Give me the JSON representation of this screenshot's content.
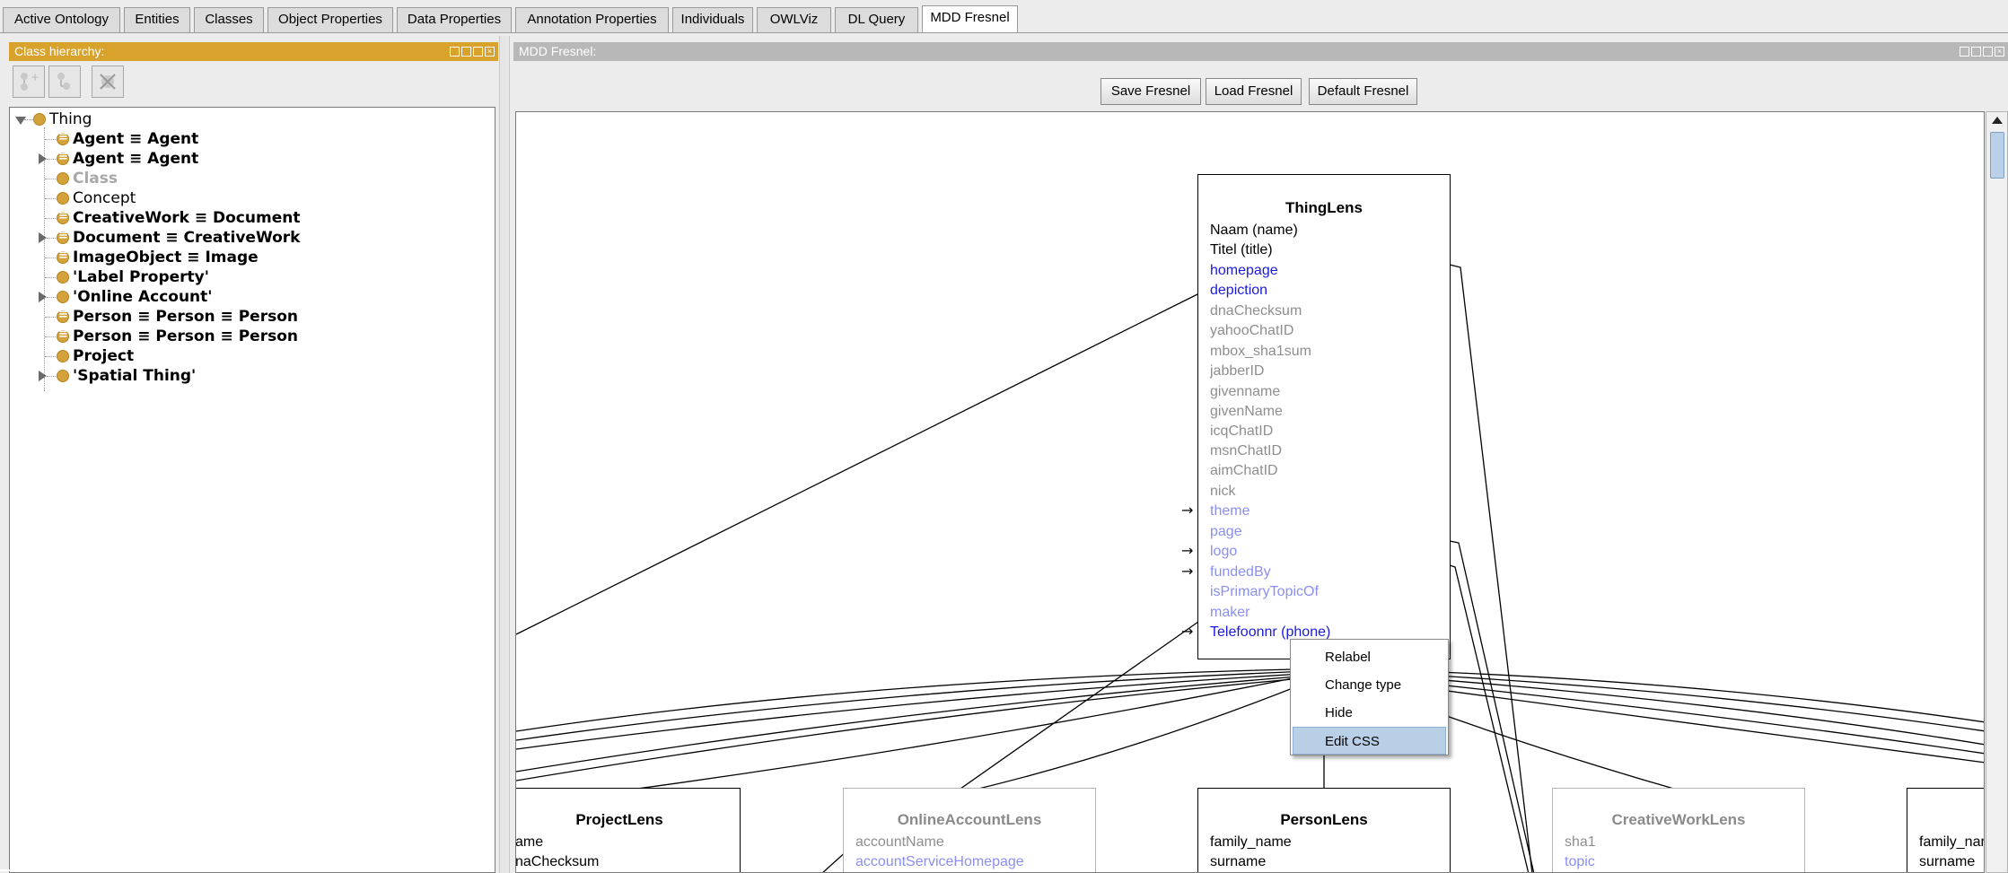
{
  "tabs": [
    {
      "label": "Active Ontology",
      "active": false
    },
    {
      "label": "Entities",
      "active": false
    },
    {
      "label": "Classes",
      "active": false
    },
    {
      "label": "Object Properties",
      "active": false
    },
    {
      "label": "Data Properties",
      "active": false
    },
    {
      "label": "Annotation Properties",
      "active": false
    },
    {
      "label": "Individuals",
      "active": false
    },
    {
      "label": "OWLViz",
      "active": false
    },
    {
      "label": "DL Query",
      "active": false
    },
    {
      "label": "MDD Fresnel",
      "active": true
    }
  ],
  "class_hierarchy": {
    "title": "Class hierarchy:",
    "toolbar_icons": [
      "add-subclass-icon",
      "add-sibling-class-icon",
      "delete-class-icon"
    ],
    "items": [
      {
        "label": "Thing",
        "style": "normal",
        "icon": "class-icon"
      },
      {
        "label": "Agent ≡ Agent",
        "style": "bold",
        "icon": "equivalent-class-icon"
      },
      {
        "label": "Agent ≡ Agent",
        "style": "bold",
        "icon": "equivalent-class-icon"
      },
      {
        "label": "Class",
        "style": "grey",
        "icon": "class-icon"
      },
      {
        "label": "Concept",
        "style": "normal",
        "icon": "class-icon"
      },
      {
        "label": "CreativeWork ≡ Document",
        "style": "bold",
        "icon": "equivalent-class-icon"
      },
      {
        "label": "Document ≡ CreativeWork",
        "style": "bold",
        "icon": "equivalent-class-icon"
      },
      {
        "label": "ImageObject ≡ Image",
        "style": "bold",
        "icon": "equivalent-class-icon"
      },
      {
        "label": "'Label Property'",
        "style": "bold",
        "icon": "class-icon"
      },
      {
        "label": "'Online Account'",
        "style": "bold",
        "icon": "class-icon"
      },
      {
        "label": "Person ≡ Person ≡ Person",
        "style": "bold",
        "icon": "equivalent-class-icon"
      },
      {
        "label": "Person ≡ Person ≡ Person",
        "style": "bold",
        "icon": "equivalent-class-icon"
      },
      {
        "label": "Project",
        "style": "bold",
        "icon": "class-icon"
      },
      {
        "label": "'Spatial Thing'",
        "style": "bold",
        "icon": "class-icon"
      }
    ]
  },
  "fresnel": {
    "title": "MDD Fresnel:",
    "buttons": {
      "save": "Save Fresnel",
      "load": "Load Fresnel",
      "default": "Default Fresnel"
    },
    "thing_lens": {
      "title": "ThingLens",
      "properties": [
        {
          "label": "Naam (name)",
          "color": "black"
        },
        {
          "label": "Titel (title)",
          "color": "black"
        },
        {
          "label": "homepage",
          "color": "blue"
        },
        {
          "label": "depiction",
          "color": "blue"
        },
        {
          "label": "dnaChecksum",
          "color": "grey"
        },
        {
          "label": "yahooChatID",
          "color": "grey"
        },
        {
          "label": "mbox_sha1sum",
          "color": "grey"
        },
        {
          "label": "jabberID",
          "color": "grey"
        },
        {
          "label": "givenname",
          "color": "grey"
        },
        {
          "label": "givenName",
          "color": "grey"
        },
        {
          "label": "icqChatID",
          "color": "grey"
        },
        {
          "label": "msnChatID",
          "color": "grey"
        },
        {
          "label": "aimChatID",
          "color": "grey"
        },
        {
          "label": "nick",
          "color": "grey"
        },
        {
          "label": "theme",
          "color": "lblue"
        },
        {
          "label": "page",
          "color": "lblue"
        },
        {
          "label": "logo",
          "color": "lblue"
        },
        {
          "label": "fundedBy",
          "color": "lblue"
        },
        {
          "label": "isPrimaryTopicOf",
          "color": "lblue"
        },
        {
          "label": "maker",
          "color": "lblue"
        },
        {
          "label": "Telefoonnr (phone)",
          "color": "blue"
        }
      ]
    },
    "project_lens": {
      "title": "ProjectLens",
      "properties": [
        "ame",
        "naChecksum"
      ]
    },
    "online_account_lens": {
      "title": "OnlineAccountLens",
      "properties": [
        "accountName",
        "accountServiceHomepage"
      ]
    },
    "person_lens": {
      "title": "PersonLens",
      "properties": [
        "family_name",
        "surname"
      ]
    },
    "creative_work_lens": {
      "title": "CreativeWorkLens",
      "properties": [
        "sha1",
        "topic"
      ]
    },
    "partial_lens": {
      "properties": [
        "family_nar",
        "surname"
      ]
    },
    "context_menu": {
      "items": [
        {
          "label": "Relabel",
          "highlighted": false
        },
        {
          "label": "Change type",
          "highlighted": false
        },
        {
          "label": "Hide",
          "highlighted": false
        },
        {
          "label": "Edit CSS",
          "highlighted": true
        }
      ]
    }
  },
  "colors": {
    "panel_header_active": "#d8a22c",
    "panel_header_inactive": "#b8b8b8",
    "class_bullet": "#d4a23a",
    "menu_highlight": "#b9cfe6",
    "blue_property": "#1a1adf",
    "light_blue_property": "#8a8ff0",
    "grey_property": "#8e8e8e"
  }
}
